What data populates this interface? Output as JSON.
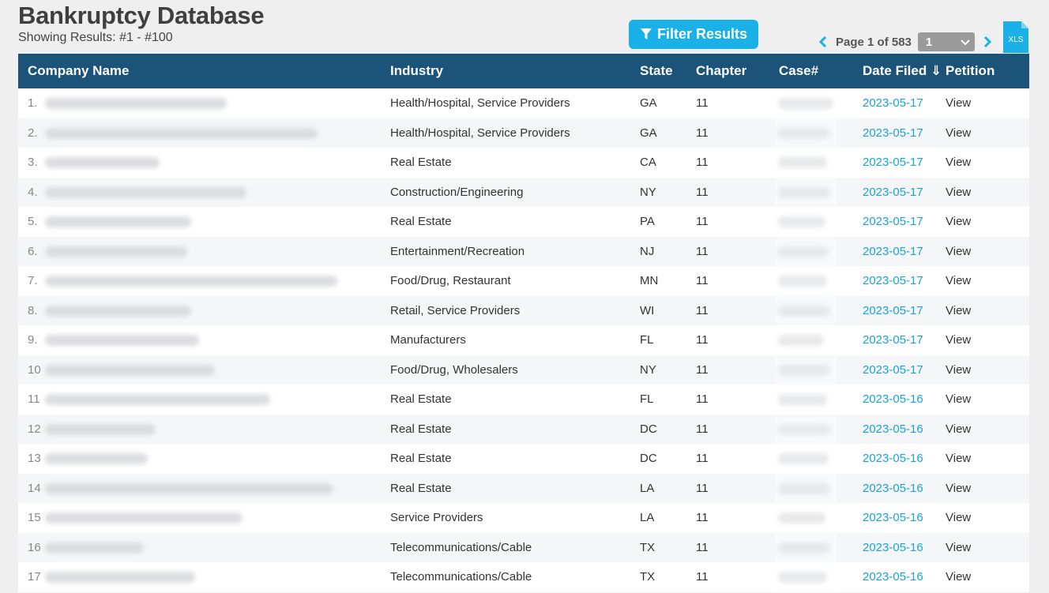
{
  "header": {
    "title": "Bankruptcy Database",
    "showing": "Showing Results: #1 - #100",
    "filter_label": "Filter Results",
    "page_text": "Page 1 of 583",
    "page_select_value": "1",
    "xls_label": "XLS"
  },
  "colors": {
    "header_bg": "#1c5378",
    "accent": "#1ab0e8",
    "date_link": "#1ba3d6"
  },
  "table": {
    "columns": {
      "company": "Company Name",
      "industry": "Industry",
      "state": "State",
      "chapter": "Chapter",
      "case": "Case#",
      "date": "Date Filed ⇓",
      "petition": "Petition"
    },
    "rows": [
      {
        "num": "1.",
        "industry": "Health/Hospital, Service Providers",
        "state": "GA",
        "chapter": "11",
        "date": "2023-05-17",
        "petition": "View"
      },
      {
        "num": "2.",
        "industry": "Health/Hospital, Service Providers",
        "state": "GA",
        "chapter": "11",
        "date": "2023-05-17",
        "petition": "View"
      },
      {
        "num": "3.",
        "industry": "Real Estate",
        "state": "CA",
        "chapter": "11",
        "date": "2023-05-17",
        "petition": "View"
      },
      {
        "num": "4.",
        "industry": "Construction/Engineering",
        "state": "NY",
        "chapter": "11",
        "date": "2023-05-17",
        "petition": "View"
      },
      {
        "num": "5.",
        "industry": "Real Estate",
        "state": "PA",
        "chapter": "11",
        "date": "2023-05-17",
        "petition": "View"
      },
      {
        "num": "6.",
        "industry": "Entertainment/Recreation",
        "state": "NJ",
        "chapter": "11",
        "date": "2023-05-17",
        "petition": "View"
      },
      {
        "num": "7.",
        "industry": "Food/Drug, Restaurant",
        "state": "MN",
        "chapter": "11",
        "date": "2023-05-17",
        "petition": "View"
      },
      {
        "num": "8.",
        "industry": "Retail, Service Providers",
        "state": "WI",
        "chapter": "11",
        "date": "2023-05-17",
        "petition": "View"
      },
      {
        "num": "9.",
        "industry": "Manufacturers",
        "state": "FL",
        "chapter": "11",
        "date": "2023-05-17",
        "petition": "View"
      },
      {
        "num": "10",
        "industry": "Food/Drug, Wholesalers",
        "state": "NY",
        "chapter": "11",
        "date": "2023-05-17",
        "petition": "View"
      },
      {
        "num": "11",
        "industry": "Real Estate",
        "state": "FL",
        "chapter": "11",
        "date": "2023-05-16",
        "petition": "View"
      },
      {
        "num": "12",
        "industry": "Real Estate",
        "state": "DC",
        "chapter": "11",
        "date": "2023-05-16",
        "petition": "View"
      },
      {
        "num": "13",
        "industry": "Real Estate",
        "state": "DC",
        "chapter": "11",
        "date": "2023-05-16",
        "petition": "View"
      },
      {
        "num": "14",
        "industry": "Real Estate",
        "state": "LA",
        "chapter": "11",
        "date": "2023-05-16",
        "petition": "View"
      },
      {
        "num": "15",
        "industry": "Service Providers",
        "state": "LA",
        "chapter": "11",
        "date": "2023-05-16",
        "petition": "View"
      },
      {
        "num": "16",
        "industry": "Telecommunications/Cable",
        "state": "TX",
        "chapter": "11",
        "date": "2023-05-16",
        "petition": "View"
      },
      {
        "num": "17",
        "industry": "Telecommunications/Cable",
        "state": "TX",
        "chapter": "11",
        "date": "2023-05-16",
        "petition": "View"
      }
    ]
  }
}
